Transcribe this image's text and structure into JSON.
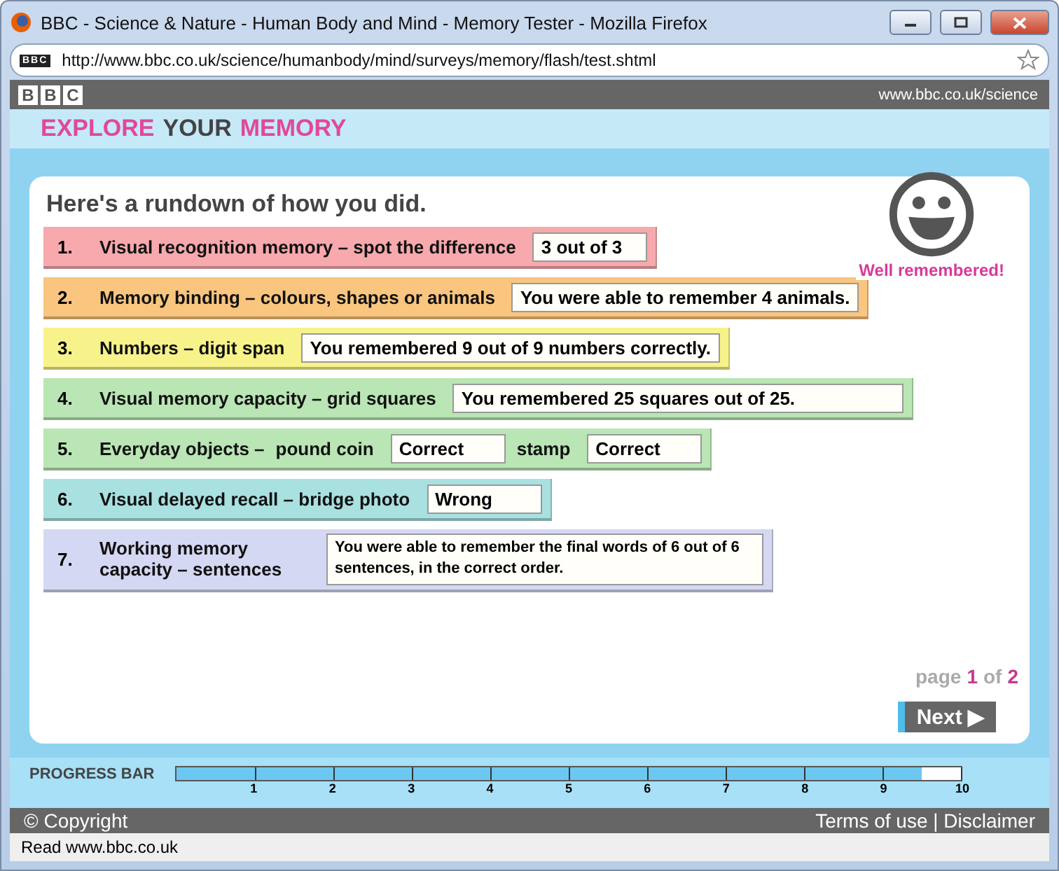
{
  "window": {
    "title": "BBC - Science & Nature - Human Body and Mind - Memory Tester - Mozilla Firefox"
  },
  "address_bar": {
    "site_badge": "BBC",
    "url": "http://www.bbc.co.uk/science/humanbody/mind/surveys/memory/flash/test.shtml"
  },
  "bbc_bar": {
    "logo": [
      "B",
      "B",
      "C"
    ],
    "site_link": "www.bbc.co.uk/science"
  },
  "header": {
    "title_parts": [
      {
        "text": "EXPLORE",
        "color": "#e0489a"
      },
      {
        "text": "YOUR",
        "color": "#444444"
      },
      {
        "text": "MEMORY",
        "color": "#e0489a"
      }
    ]
  },
  "results": {
    "heading": "Here's a rundown of how you did.",
    "feedback": "Well remembered!",
    "rows": [
      {
        "kind": "single",
        "number": "1.",
        "label": "Visual recognition memory – spot the difference",
        "result": "3 out of 3",
        "color": "#f7a9ae"
      },
      {
        "kind": "single",
        "number": "2.",
        "label": "Memory binding – colours, shapes or animals",
        "result": "You were able to remember 4 animals.",
        "color": "#f9c57f"
      },
      {
        "kind": "single",
        "number": "3.",
        "label": "Numbers – digit span",
        "result": "You remembered 9 out of 9 numbers correctly.",
        "color": "#f7f28a"
      },
      {
        "kind": "single",
        "number": "4.",
        "label": "Visual memory capacity – grid squares",
        "result": "You remembered 25 squares out of 25.",
        "color": "#b9e6b4"
      },
      {
        "kind": "pair",
        "number": "5.",
        "label": "Everyday objects –",
        "items": [
          {
            "label": "pound coin",
            "result": "Correct"
          },
          {
            "label": "stamp",
            "result": "Correct"
          }
        ],
        "color": "#b9e6b4"
      },
      {
        "kind": "single",
        "number": "6.",
        "label": "Visual delayed recall – bridge photo",
        "result": "Wrong",
        "color": "#a9e0e0"
      },
      {
        "kind": "single",
        "number": "7.",
        "label": "Working memory capacity – sentences",
        "result": "You were able to remember the final words of 6 out of 6 sentences, in the correct order.",
        "color": "#d5d8f2"
      }
    ],
    "pager": {
      "word": "page",
      "current": "1",
      "of": "of",
      "total": "2"
    },
    "next_button": "Next ▶"
  },
  "progress": {
    "label": "PROGRESS BAR",
    "level": 0.95,
    "ticks": [
      "1",
      "2",
      "3",
      "4",
      "5",
      "6",
      "7",
      "8",
      "9",
      "10"
    ]
  },
  "footer": {
    "left": "© Copyright",
    "right": "Terms of use | Disclaimer"
  },
  "status_bar": "Read www.bbc.co.uk"
}
